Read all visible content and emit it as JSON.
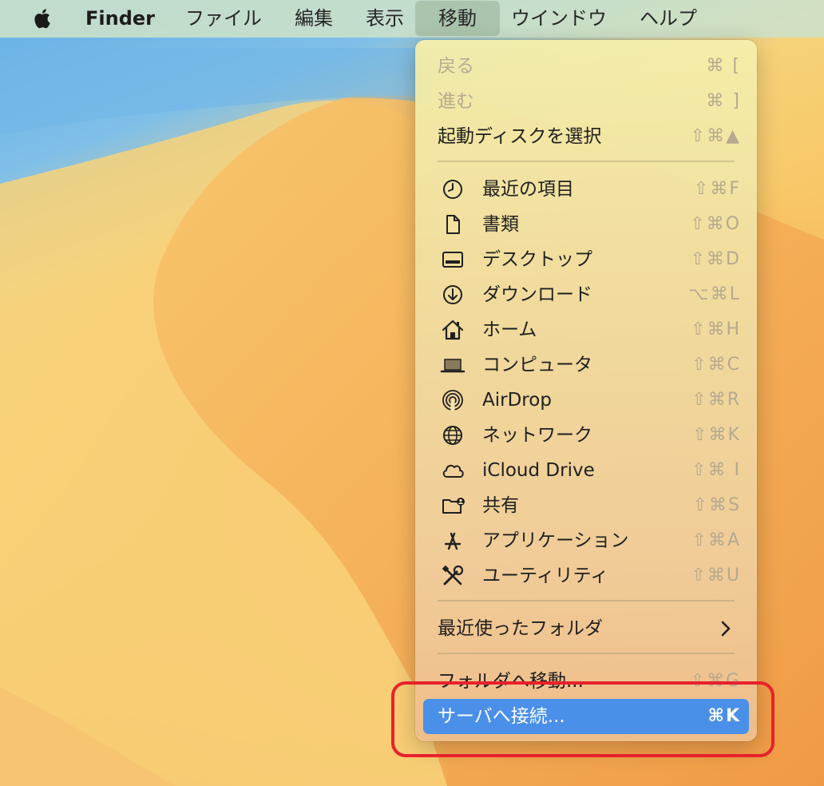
{
  "menubar": {
    "app_name": "Finder",
    "items": [
      {
        "label": "ファイル"
      },
      {
        "label": "編集"
      },
      {
        "label": "表示"
      },
      {
        "label": "移動",
        "active": true
      },
      {
        "label": "ウインドウ"
      },
      {
        "label": "ヘルプ"
      }
    ]
  },
  "menu": {
    "back": {
      "label": "戻る",
      "shortcut": "⌘ ["
    },
    "forward": {
      "label": "進む",
      "shortcut": "⌘ ]"
    },
    "startup_disk": {
      "label": "起動ディスクを選択",
      "shortcut": "⇧⌘▲"
    },
    "places": [
      {
        "label": "最近の項目",
        "shortcut": "⇧⌘F",
        "icon": "clock-icon"
      },
      {
        "label": "書類",
        "shortcut": "⇧⌘O",
        "icon": "document-icon"
      },
      {
        "label": "デスクトップ",
        "shortcut": "⇧⌘D",
        "icon": "desktop-icon"
      },
      {
        "label": "ダウンロード",
        "shortcut": "⌥⌘L",
        "icon": "download-icon"
      },
      {
        "label": "ホーム",
        "shortcut": "⇧⌘H",
        "icon": "home-icon"
      },
      {
        "label": "コンピュータ",
        "shortcut": "⇧⌘C",
        "icon": "laptop-icon"
      },
      {
        "label": "AirDrop",
        "shortcut": "⇧⌘R",
        "icon": "airdrop-icon"
      },
      {
        "label": "ネットワーク",
        "shortcut": "⇧⌘K",
        "icon": "globe-icon"
      },
      {
        "label": "iCloud Drive",
        "shortcut": "⇧⌘ I",
        "icon": "cloud-icon"
      },
      {
        "label": "共有",
        "shortcut": "⇧⌘S",
        "icon": "shared-folder-icon"
      },
      {
        "label": "アプリケーション",
        "shortcut": "⇧⌘A",
        "icon": "applications-icon"
      },
      {
        "label": "ユーティリティ",
        "shortcut": "⇧⌘U",
        "icon": "utilities-icon"
      }
    ],
    "recent_folders": {
      "label": "最近使ったフォルダ"
    },
    "go_to_folder": {
      "label": "フォルダへ移動...",
      "shortcut": "⇧⌘G"
    },
    "connect_server": {
      "label": "サーバへ接続...",
      "shortcut": "⌘K"
    }
  },
  "colors": {
    "highlight": "#4a8fe8",
    "annotation": "#e8212b"
  }
}
